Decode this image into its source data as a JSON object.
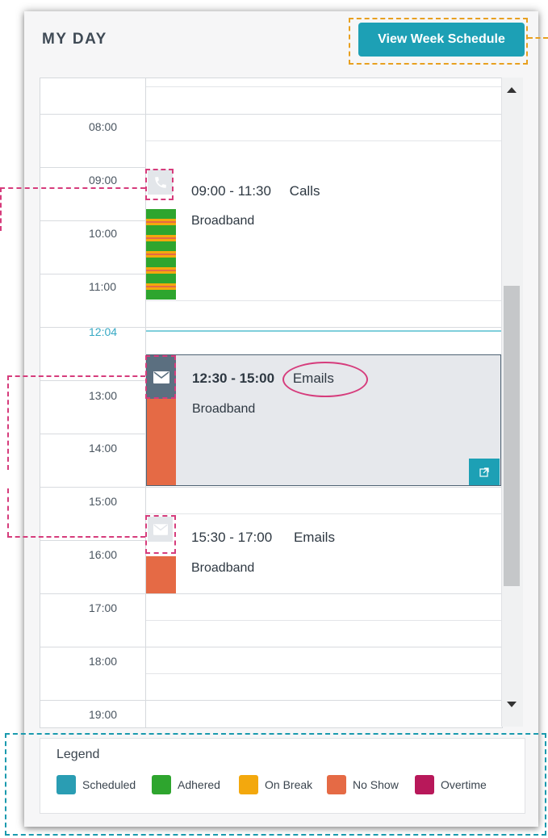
{
  "header": {
    "title": "MY DAY",
    "week_button": "View Week Schedule"
  },
  "times": [
    "08:00",
    "09:00",
    "10:00",
    "11:00",
    "12:04",
    "13:00",
    "14:00",
    "15:00",
    "16:00",
    "17:00",
    "18:00",
    "19:00"
  ],
  "events": [
    {
      "time": "09:00 - 11:30",
      "activity": "Calls",
      "queue": "Broadband",
      "icon": "phone-icon"
    },
    {
      "time": "12:30 - 15:00",
      "activity": "Emails",
      "queue": "Broadband",
      "icon": "mail-icon"
    },
    {
      "time": "15:30 - 17:00",
      "activity": "Emails",
      "queue": "Broadband",
      "icon": "mail-icon"
    }
  ],
  "legend": {
    "title": "Legend",
    "items": [
      {
        "label": "Scheduled",
        "color": "#2a9db3"
      },
      {
        "label": "Adhered",
        "color": "#2ea52e"
      },
      {
        "label": "On Break",
        "color": "#f3a80d"
      },
      {
        "label": "No Show",
        "color": "#e56a45"
      },
      {
        "label": "Overtime",
        "color": "#b8185a"
      }
    ]
  },
  "colors": {
    "accent": "#1da0b5",
    "adhered": "#2ea52e",
    "on_break": "#f3a80d",
    "no_show": "#e56a45",
    "now_line": "#7fcfdb"
  }
}
